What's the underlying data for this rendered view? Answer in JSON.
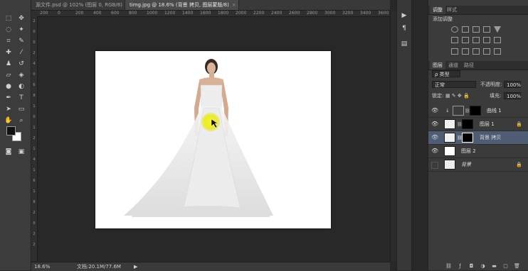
{
  "document_tabs": [
    {
      "label": "源文件.psd @ 102% (图层 0, RGB/8)",
      "close": "×",
      "active": false
    },
    {
      "label": "timg.jpg @ 18.6% (背景 拷贝, 图层蒙版/8)",
      "close": "×",
      "active": true
    }
  ],
  "ruler": {
    "h_labels": [
      "200",
      "0",
      "200",
      "400",
      "600",
      "800",
      "1000",
      "1200",
      "1400",
      "1600",
      "1800",
      "2000",
      "2200",
      "2400",
      "2600",
      "2800",
      "3000",
      "3200",
      "3400",
      "3600"
    ],
    "v_labels": [
      "2",
      "0",
      "0",
      "2",
      "4",
      "0",
      "6",
      "8",
      "1",
      "0",
      "1",
      "2",
      "1",
      "4",
      "1",
      "6",
      "1",
      "8",
      "2",
      "0",
      "2",
      "2"
    ]
  },
  "status": {
    "zoom": "18.6%",
    "doc": "文档:20.1M/77.6M"
  },
  "panels": {
    "adjust_tabs": [
      "调整",
      "样式"
    ],
    "adjust_title": "添加调整",
    "layer_tabs": [
      "图层",
      "通道",
      "路径"
    ],
    "filter_kind": "ρ 类型",
    "blend_mode": "正常",
    "opacity_label": "不透明度:",
    "opacity_value": "100%",
    "lock_label": "锁定:",
    "fill_label": "填充:",
    "fill_value": "100%",
    "layers": [
      {
        "name": "曲线 1",
        "visible": true,
        "type": "adjustment",
        "locked": false,
        "selected": false
      },
      {
        "name": "图层 1",
        "visible": true,
        "type": "masked",
        "locked": true,
        "selected": false
      },
      {
        "name": "背景 拷贝",
        "visible": true,
        "type": "masked",
        "locked": false,
        "selected": true
      },
      {
        "name": "图层 2",
        "visible": true,
        "type": "white",
        "locked": false,
        "selected": false
      },
      {
        "name": "背景",
        "visible": false,
        "type": "photo",
        "locked": true,
        "selected": false
      }
    ]
  },
  "colors": {
    "foreground": "#111111",
    "background": "#ffffff",
    "selection": "#4e5c74",
    "cursor_highlight": "#f4f21a"
  }
}
